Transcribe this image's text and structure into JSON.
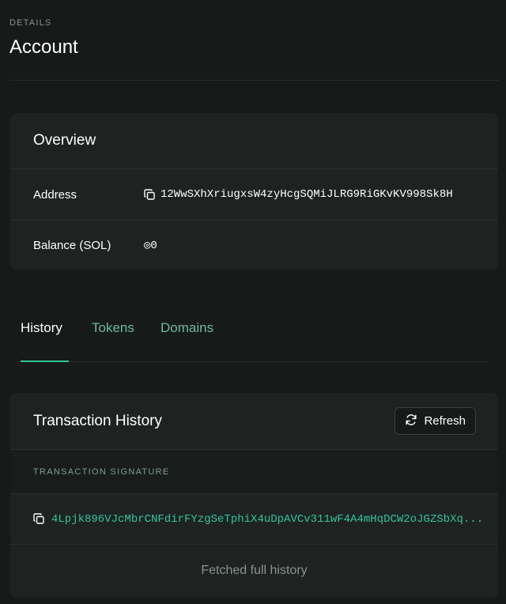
{
  "header": {
    "eyebrow": "DETAILS",
    "title": "Account"
  },
  "overview": {
    "title": "Overview",
    "rows": [
      {
        "label": "Address",
        "value": "12WwSXhXriugxsW4zyHcgSQMiJLRG9RiGKvKV998Sk8H",
        "icon": "copy-icon"
      },
      {
        "label": "Balance (SOL)",
        "value": "◎0"
      }
    ]
  },
  "tabs": [
    {
      "label": "History",
      "active": true
    },
    {
      "label": "Tokens",
      "active": false
    },
    {
      "label": "Domains",
      "active": false
    }
  ],
  "history": {
    "title": "Transaction History",
    "refresh_label": "Refresh",
    "column_header": "TRANSACTION SIGNATURE",
    "rows": [
      {
        "signature": "4Lpjk896VJcMbrCNFdirFYzgSeTphiX4uDpAVCv311wF4A4mHqDCW2oJGZSbXq..."
      }
    ],
    "status": "Fetched full history"
  },
  "colors": {
    "background": "#161a19",
    "card": "#1e2322",
    "accent": "#33c49a",
    "tab_inactive": "#6fb7a3",
    "muted": "#8a9290"
  }
}
